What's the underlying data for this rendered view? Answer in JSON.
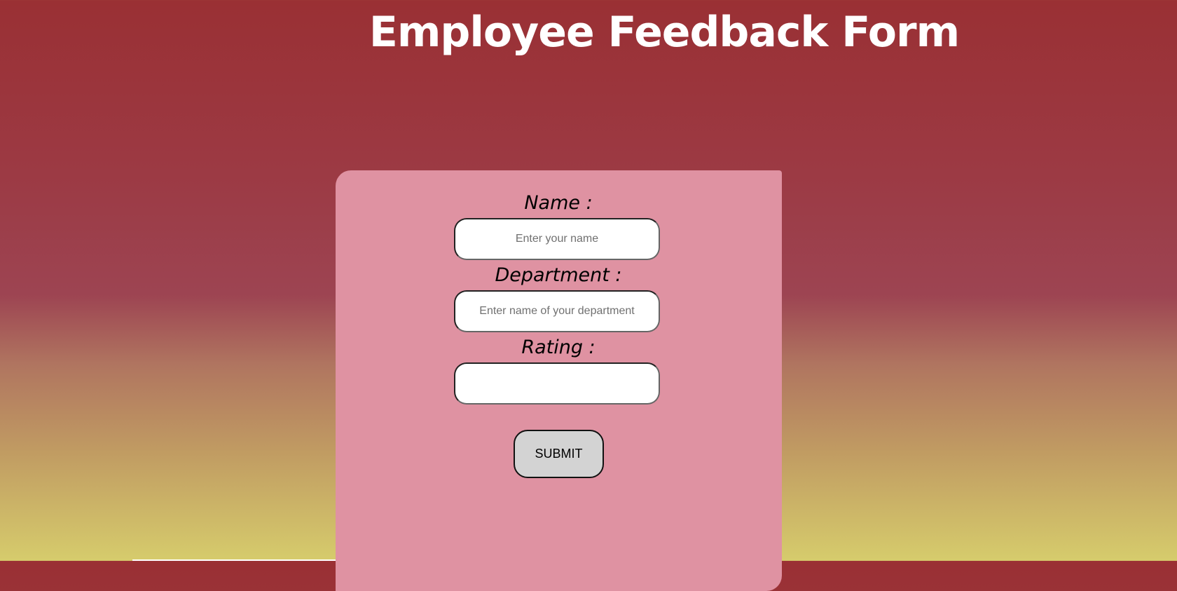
{
  "header": {
    "title": "Employee Feedback Form"
  },
  "form": {
    "name": {
      "label": "Name :",
      "placeholder": "Enter your name",
      "value": ""
    },
    "department": {
      "label": "Department :",
      "placeholder": "Enter name of your department",
      "value": ""
    },
    "rating": {
      "label": "Rating :",
      "placeholder": "",
      "value": ""
    },
    "submit_label": "SUBMIT"
  }
}
